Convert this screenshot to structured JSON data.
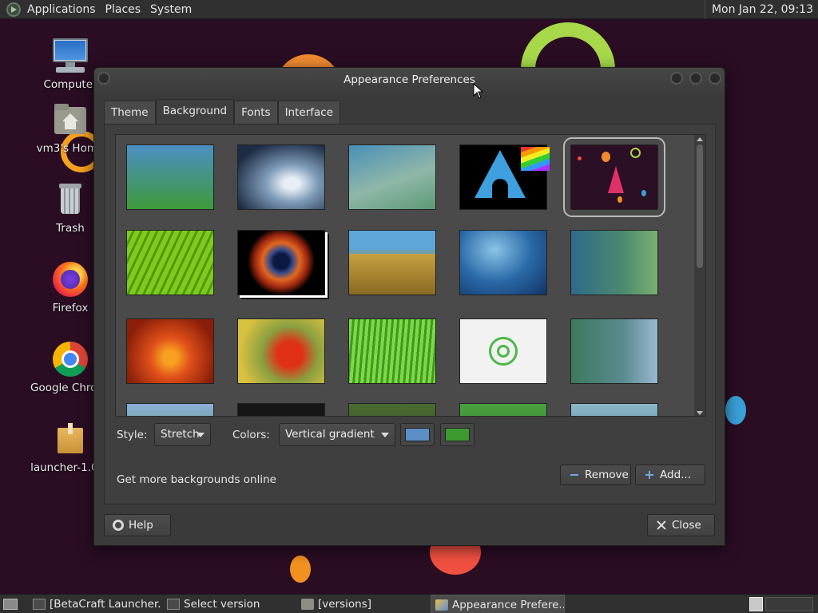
{
  "top_panel": {
    "menus": [
      "Applications",
      "Places",
      "System"
    ],
    "clock": "Mon Jan 22, 09:13"
  },
  "desktop_icons": [
    {
      "label": "Computer",
      "icon": "computer-icon"
    },
    {
      "label": "vm3's Home",
      "icon": "home-folder-icon"
    },
    {
      "label": "Trash",
      "icon": "trash-icon"
    },
    {
      "label": "Firefox",
      "icon": "firefox-icon"
    },
    {
      "label": "Google Chrome",
      "icon": "chrome-icon"
    },
    {
      "label": "launcher-1.09_",
      "icon": "package-icon"
    }
  ],
  "window": {
    "title": "Appearance Preferences",
    "tabs": [
      "Theme",
      "Background",
      "Fonts",
      "Interface"
    ],
    "active_tab": "Background",
    "style_label": "Style:",
    "style_value": "Stretch",
    "colors_label": "Colors:",
    "colors_value": "Vertical gradient",
    "primary_color": "#5b8fc6",
    "secondary_color": "#3d9a2f",
    "online_link": "Get more backgrounds online",
    "remove_label": "Remove",
    "add_label": "Add...",
    "help_label": "Help",
    "close_label": "Close",
    "selected_wallpaper_index": 4
  },
  "taskbar": {
    "tasks": [
      {
        "label": "[BetaCraft Launcher..."
      },
      {
        "label": "Select version"
      },
      {
        "label": "[versions]"
      },
      {
        "label": "Appearance Prefere..."
      }
    ]
  }
}
